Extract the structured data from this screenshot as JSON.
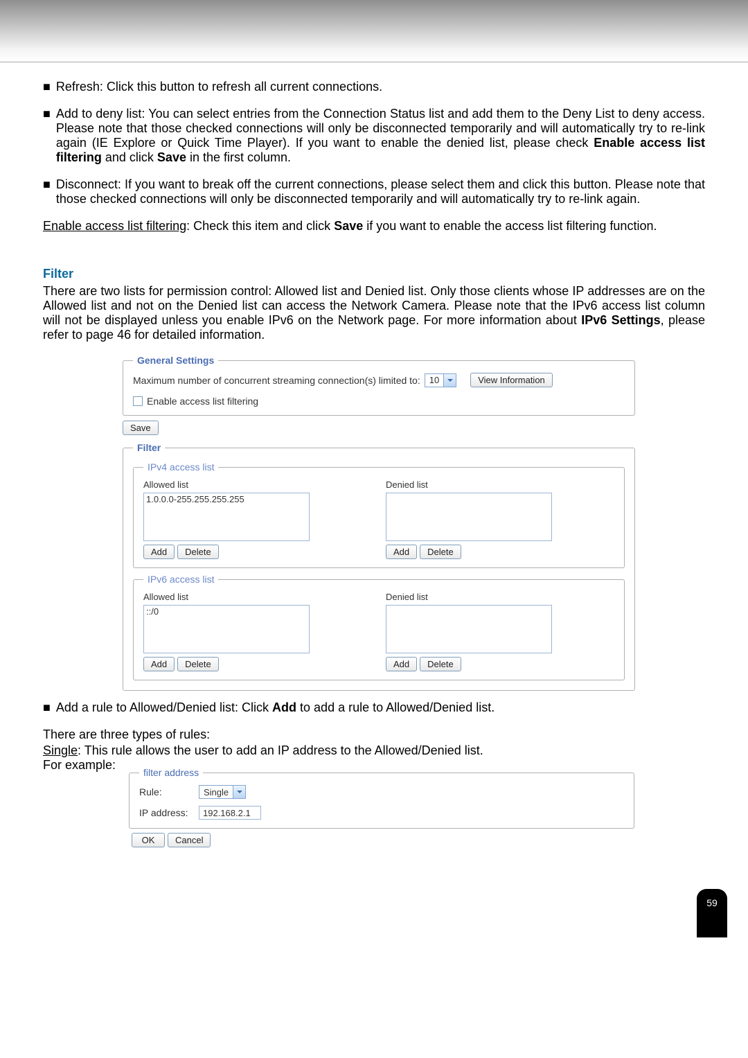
{
  "bullets": {
    "refresh": "Refresh: Click this button to refresh all current connections.",
    "add_deny": "Add to deny list: You can select entries from the Connection Status list and add them to the Deny List to deny access. Please note that those checked connections will only be disconnected temporarily and will automatically try to re-link again (IE Explore or Quick Time Player). If you want to enable the denied list, please check ",
    "add_deny_bold": "Enable access list filtering",
    "add_deny_tail": " and click ",
    "add_deny_save": "Save",
    "add_deny_end": " in the first column.",
    "disconnect": "Disconnect: If you want to break off the current connections, please select them and click this button. Please note that those checked connections will only be disconnected temporarily and will automatically try to re-link again."
  },
  "enable_para_u": "Enable access list filtering",
  "enable_para_rest": ": Check this item and click ",
  "enable_para_save": "Save",
  "enable_para_tail": " if you want to enable the access list filtering function.",
  "filter_heading": "Filter",
  "filter_body_1": "There are two lists for permission control: Allowed list and Denied list. Only those clients whose IP addresses are on the Allowed list and not on the Denied list can access the Network Camera. Please note that the IPv6 access list column will not be displayed unless you enable IPv6 on the Network page. For more information about ",
  "filter_body_bold": "IPv6 Settings",
  "filter_body_2": ", please refer to page 46 for detailed information.",
  "gs": {
    "legend": "General Settings",
    "max_label": "Maximum number of concurrent streaming connection(s) limited to:",
    "max_value": "10",
    "view_info": "View Information",
    "enable_checkbox": "Enable access list filtering",
    "save": "Save"
  },
  "filterbox": {
    "legend": "Filter",
    "ipv4_legend": "IPv4 access list",
    "ipv6_legend": "IPv6 access list",
    "allowed": "Allowed list",
    "denied": "Denied list",
    "ipv4_allowed_entry": "1.0.0.0-255.255.255.255",
    "ipv6_allowed_entry": "::/0",
    "add": "Add",
    "delete": "Delete"
  },
  "add_rule_bullet_1": "Add a rule to Allowed/Denied list: Click ",
  "add_rule_bold": "Add",
  "add_rule_bullet_2": " to add a rule to Allowed/Denied list.",
  "rules_intro": "There are three types of rules:",
  "single_u": "Single",
  "single_rest": ": This rule allows the user to add an IP address to the Allowed/Denied list.",
  "for_example": "For example:",
  "fa": {
    "legend": "filter address",
    "rule_label": "Rule:",
    "rule_value": "Single",
    "ip_label": "IP address:",
    "ip_value": "192.168.2.1",
    "ok": "OK",
    "cancel": "Cancel"
  },
  "page_number": "59"
}
